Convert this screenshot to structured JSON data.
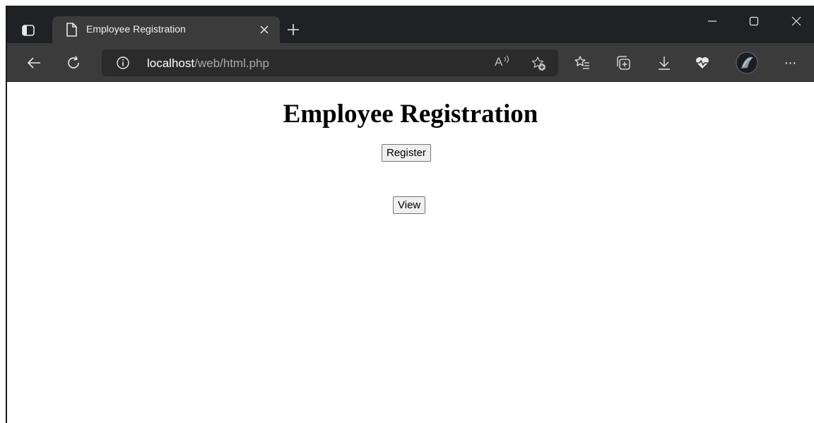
{
  "browser": {
    "tab": {
      "title": "Employee Registration",
      "icon": "document-icon",
      "close_icon": "close-icon"
    },
    "new_tab_icon": "plus-icon",
    "window_controls": [
      "minimize-icon",
      "maximize-icon",
      "close-icon"
    ],
    "address_bar": {
      "info_icon": "info-icon",
      "url_host": "localhost",
      "url_path": "/web/html.php"
    },
    "toolbar_icons": [
      "back-icon",
      "refresh-icon",
      "read-aloud-icon",
      "add-favorite-icon",
      "favorites-icon",
      "collections-icon",
      "downloads-icon",
      "health-icon",
      "profile-avatar",
      "more-icon"
    ],
    "read_aloud_label": "A",
    "more_label": "···"
  },
  "page": {
    "heading": "Employee Registration",
    "buttons": {
      "register": "Register",
      "view": "View"
    }
  },
  "colors": {
    "tabstrip": "#202124",
    "toolbar": "#3b3b3b",
    "address_bar": "#2b2b2b"
  }
}
